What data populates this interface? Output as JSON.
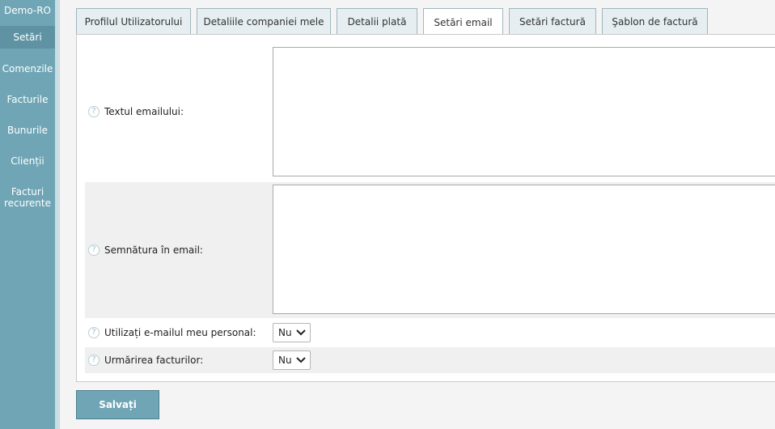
{
  "sidebar": {
    "account": "Demo-RO",
    "items": [
      {
        "label": "Setări"
      },
      {
        "label": "Comenzile"
      },
      {
        "label": "Facturile"
      },
      {
        "label": "Bunurile"
      },
      {
        "label": "Clienții"
      },
      {
        "label": "Facturi recurente"
      }
    ]
  },
  "tabs": [
    {
      "label": "Profilul Utilizatorului"
    },
    {
      "label": "Detaliile companiei mele"
    },
    {
      "label": "Detalii plată"
    },
    {
      "label": "Setări email"
    },
    {
      "label": "Setări factură"
    },
    {
      "label": "Şablon de factură"
    }
  ],
  "form": {
    "help_icon": "?",
    "email_text_label": "Textul emailului:",
    "email_text_value": "",
    "signature_label": "Semnătura în email:",
    "signature_value": "",
    "personal_email_label": "Utilizați e-mailul meu personal:",
    "personal_email_value": "Nu",
    "tracking_label": "Urmărirea facturilor:",
    "tracking_value": "Nu"
  },
  "actions": {
    "save_label": "Salvați"
  },
  "colors": {
    "accent": "#6fa5b5",
    "active_sidebar": "#5f93a4"
  }
}
